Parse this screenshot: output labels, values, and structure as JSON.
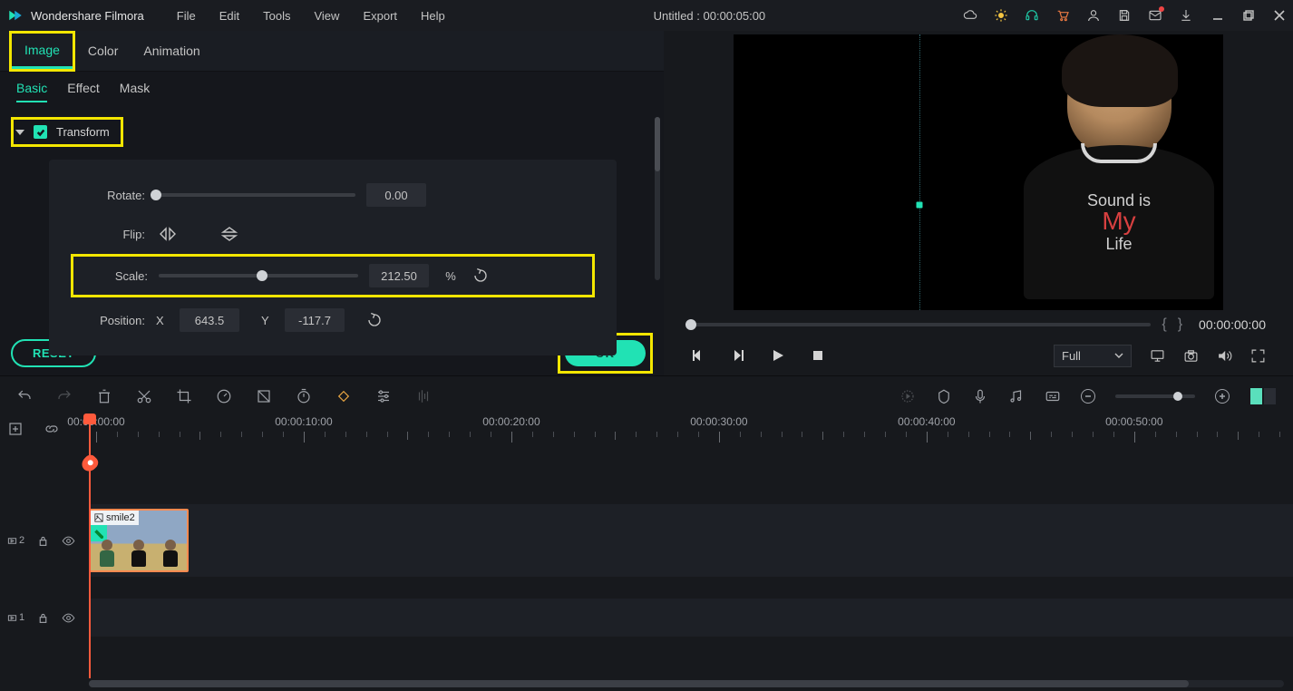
{
  "app_name": "Wondershare Filmora",
  "menu_bar": {
    "file": "File",
    "edit": "Edit",
    "tools": "Tools",
    "view": "View",
    "export": "Export",
    "help": "Help"
  },
  "project_title": "Untitled : 00:00:05:00",
  "prop_header_tabs": {
    "image": "Image",
    "color": "Color",
    "animation": "Animation"
  },
  "prop_sub_tabs": {
    "basic": "Basic",
    "effect": "Effect",
    "mask": "Mask"
  },
  "transform": {
    "section_label": "Transform",
    "rotate_label": "Rotate:",
    "rotate_value": "0.00",
    "flip_label": "Flip:",
    "scale_label": "Scale:",
    "scale_value": "212.50",
    "scale_unit": "%",
    "position_label": "Position:",
    "pos_x_label": "X",
    "pos_x_value": "643.5",
    "pos_y_label": "Y",
    "pos_y_value": "-117.7"
  },
  "buttons": {
    "reset": "RESET",
    "ok": "OK"
  },
  "preview": {
    "timecode": "00:00:00:00",
    "quality": "Full",
    "shirt_line1": "Sound is",
    "shirt_big": "My",
    "shirt_line2": "Life"
  },
  "timeline": {
    "marks": [
      "00:00:00:00",
      "00:00:10:00",
      "00:00:20:00",
      "00:00:30:00",
      "00:00:40:00",
      "00:00:50:00"
    ],
    "clip_name": "smile2",
    "track2_label": "2",
    "track1_label": "1"
  }
}
